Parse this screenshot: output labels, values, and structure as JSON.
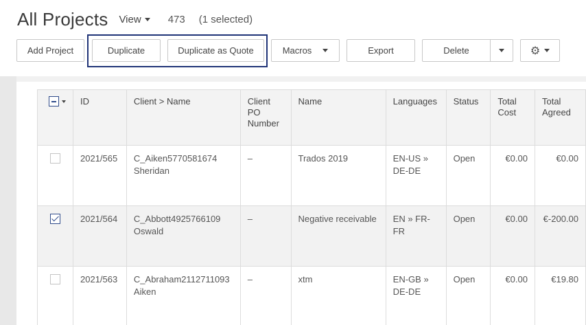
{
  "header": {
    "title": "All Projects",
    "view_label": "View",
    "count": "473",
    "selected": "(1 selected)"
  },
  "toolbar": {
    "add_project": "Add Project",
    "duplicate": "Duplicate",
    "duplicate_as_quote": "Duplicate as Quote",
    "macros": "Macros",
    "export": "Export",
    "delete": "Delete",
    "settings_icon": "gear-icon"
  },
  "table": {
    "columns": {
      "id": "ID",
      "client_name": "Client > Name",
      "client_po": "Client PO Number",
      "name": "Name",
      "languages": "Languages",
      "status": "Status",
      "total_cost": "Total Cost",
      "total_agreed": "Total Agreed"
    },
    "rows": [
      {
        "checked": false,
        "id": "2021/565",
        "client": "C_Aiken5770581674 Sheridan",
        "po": "–",
        "name": "Trados 2019",
        "languages": "EN-US » DE-DE",
        "status": "Open",
        "total_cost": "€0.00",
        "total_agreed": "€0.00"
      },
      {
        "checked": true,
        "id": "2021/564",
        "client": "C_Abbott4925766109 Oswald",
        "po": "–",
        "name": "Negative receivable",
        "languages": "EN » FR-FR",
        "status": "Open",
        "total_cost": "€0.00",
        "total_agreed": "€-200.00"
      },
      {
        "checked": false,
        "id": "2021/563",
        "client": "C_Abraham2112711093 Aiken",
        "po": "–",
        "name": "xtm",
        "languages": "EN-GB » DE-DE",
        "status": "Open",
        "total_cost": "€0.00",
        "total_agreed": "€19.80"
      }
    ]
  }
}
